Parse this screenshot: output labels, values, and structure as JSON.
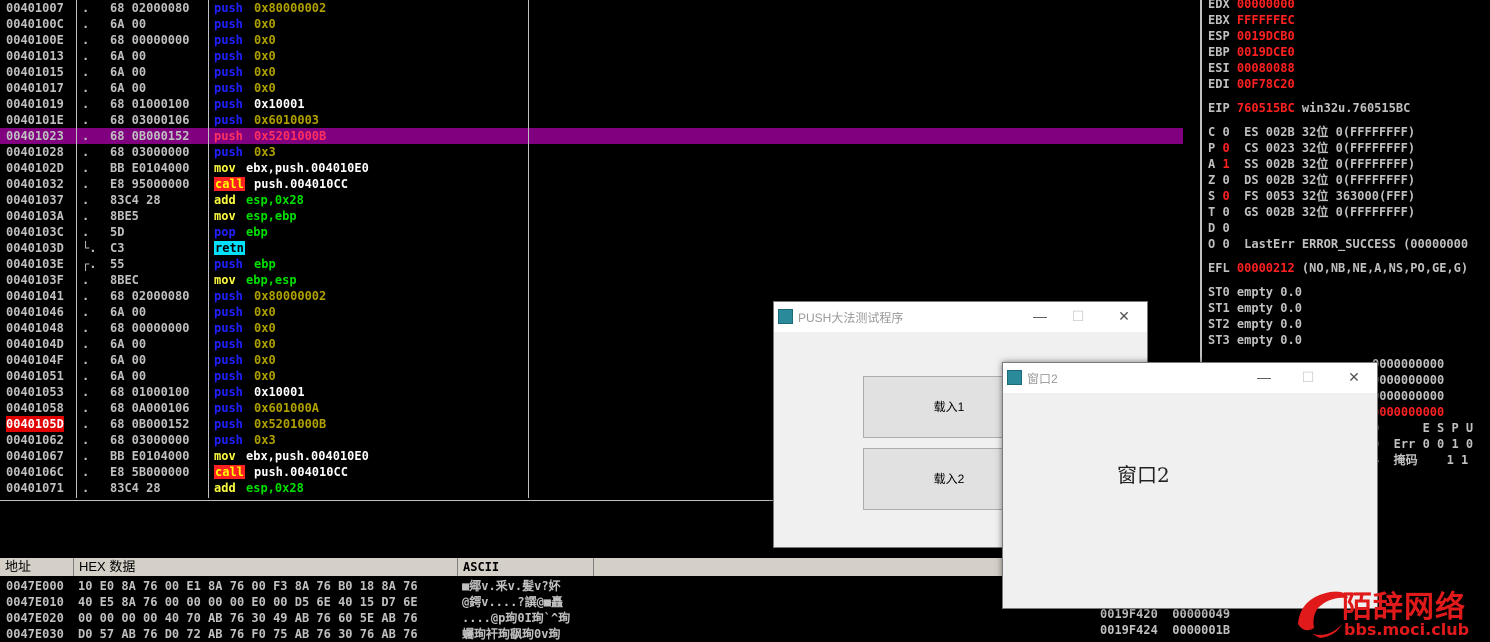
{
  "disasm": {
    "rows": [
      {
        "addr": "00401007",
        "flow": ".",
        "hex": "68 02000080",
        "mn": "push",
        "op": "0x80000002",
        "mc": "blue",
        "oc": "olive"
      },
      {
        "addr": "0040100C",
        "flow": ".",
        "hex": "6A 00",
        "mn": "push",
        "op": "0x0",
        "mc": "blue",
        "oc": "olive"
      },
      {
        "addr": "0040100E",
        "flow": ".",
        "hex": "68 00000000",
        "mn": "push",
        "op": "0x0",
        "mc": "blue",
        "oc": "olive"
      },
      {
        "addr": "00401013",
        "flow": ".",
        "hex": "6A 00",
        "mn": "push",
        "op": "0x0",
        "mc": "blue",
        "oc": "olive"
      },
      {
        "addr": "00401015",
        "flow": ".",
        "hex": "6A 00",
        "mn": "push",
        "op": "0x0",
        "mc": "blue",
        "oc": "olive"
      },
      {
        "addr": "00401017",
        "flow": ".",
        "hex": "6A 00",
        "mn": "push",
        "op": "0x0",
        "mc": "blue",
        "oc": "olive"
      },
      {
        "addr": "00401019",
        "flow": ".",
        "hex": "68 01000100",
        "mn": "push",
        "op": "0x10001",
        "mc": "blue",
        "oc": "white"
      },
      {
        "addr": "0040101E",
        "flow": ".",
        "hex": "68 03000106",
        "mn": "push",
        "op": "0x6010003",
        "mc": "blue",
        "oc": "olive"
      },
      {
        "addr": "00401023",
        "flow": ".",
        "hex": "68 0B000152",
        "mn": "push",
        "op": "0x5201000B",
        "mc": "red",
        "oc": "red",
        "sel": true
      },
      {
        "addr": "00401028",
        "flow": ".",
        "hex": "68 03000000",
        "mn": "push",
        "op": "0x3",
        "mc": "blue",
        "oc": "olive"
      },
      {
        "addr": "0040102D",
        "flow": ".",
        "hex": "BB E0104000",
        "mn": "mov",
        "op": "ebx,push.004010E0",
        "mc": "yellow",
        "oc": "white"
      },
      {
        "addr": "00401032",
        "flow": ".",
        "hex": "E8 95000000",
        "mn": "call",
        "op": "push.004010CC",
        "mc": "call",
        "oc": "white"
      },
      {
        "addr": "00401037",
        "flow": ".",
        "hex": "83C4 28",
        "mn": "add",
        "op": "esp,0x28",
        "mc": "yellow",
        "oc": "green"
      },
      {
        "addr": "0040103A",
        "flow": ".",
        "hex": "8BE5",
        "mn": "mov",
        "op": "esp,ebp",
        "mc": "yellow",
        "oc": "green"
      },
      {
        "addr": "0040103C",
        "flow": ".",
        "hex": "5D",
        "mn": "pop",
        "op": "ebp",
        "mc": "blue",
        "oc": "green"
      },
      {
        "addr": "0040103D",
        "flow": "└.",
        "hex": "C3",
        "mn": "retn",
        "op": "",
        "mc": "retn",
        "oc": "white"
      },
      {
        "addr": "0040103E",
        "flow": "┌.",
        "hex": "55",
        "mn": "push",
        "op": "ebp",
        "mc": "blue",
        "oc": "green"
      },
      {
        "addr": "0040103F",
        "flow": ".",
        "hex": "8BEC",
        "mn": "mov",
        "op": "ebp,esp",
        "mc": "yellow",
        "oc": "green"
      },
      {
        "addr": "00401041",
        "flow": ".",
        "hex": "68 02000080",
        "mn": "push",
        "op": "0x80000002",
        "mc": "blue",
        "oc": "olive"
      },
      {
        "addr": "00401046",
        "flow": ".",
        "hex": "6A 00",
        "mn": "push",
        "op": "0x0",
        "mc": "blue",
        "oc": "olive"
      },
      {
        "addr": "00401048",
        "flow": ".",
        "hex": "68 00000000",
        "mn": "push",
        "op": "0x0",
        "mc": "blue",
        "oc": "olive"
      },
      {
        "addr": "0040104D",
        "flow": ".",
        "hex": "6A 00",
        "mn": "push",
        "op": "0x0",
        "mc": "blue",
        "oc": "olive"
      },
      {
        "addr": "0040104F",
        "flow": ".",
        "hex": "6A 00",
        "mn": "push",
        "op": "0x0",
        "mc": "blue",
        "oc": "olive"
      },
      {
        "addr": "00401051",
        "flow": ".",
        "hex": "6A 00",
        "mn": "push",
        "op": "0x0",
        "mc": "blue",
        "oc": "olive"
      },
      {
        "addr": "00401053",
        "flow": ".",
        "hex": "68 01000100",
        "mn": "push",
        "op": "0x10001",
        "mc": "blue",
        "oc": "white"
      },
      {
        "addr": "00401058",
        "flow": ".",
        "hex": "68 0A000106",
        "mn": "push",
        "op": "0x601000A",
        "mc": "blue",
        "oc": "olive"
      },
      {
        "addr": "0040105D",
        "flow": ".",
        "hex": "68 0B000152",
        "mn": "push",
        "op": "0x5201000B",
        "mc": "blue",
        "oc": "olive",
        "bp": true
      },
      {
        "addr": "00401062",
        "flow": ".",
        "hex": "68 03000000",
        "mn": "push",
        "op": "0x3",
        "mc": "blue",
        "oc": "olive"
      },
      {
        "addr": "00401067",
        "flow": ".",
        "hex": "BB E0104000",
        "mn": "mov",
        "op": "ebx,push.004010E0",
        "mc": "yellow",
        "oc": "white"
      },
      {
        "addr": "0040106C",
        "flow": ".",
        "hex": "E8 5B000000",
        "mn": "call",
        "op": "push.004010CC",
        "mc": "call",
        "oc": "white"
      },
      {
        "addr": "00401071",
        "flow": ".",
        "hex": "83C4 28",
        "mn": "add",
        "op": "esp,0x28",
        "mc": "yellow",
        "oc": "green"
      }
    ]
  },
  "dump": {
    "headers": {
      "addr": "地址",
      "hex": "HEX 数据",
      "ascii": "ASCII"
    },
    "rows": [
      {
        "addr": "0047E000",
        "hex": "10 E0 8A 76 00 E1 8A 76 00 F3 8A 76 B0 18 8A 76",
        "ascii": "■鄊v.釆v.髪v?妚"
      },
      {
        "addr": "0047E010",
        "hex": "40 E5 8A 76 00 00 00 00 E0 00 D5 6E 40 15 D7 6E",
        "ascii": "@鍔v....?譔@■矗"
      },
      {
        "addr": "0047E020",
        "hex": "00 00 00 00 40 70 AB 76 30 49 AB 76 60 5E AB 76",
        "ascii": "....@p珣0I珣`^珣"
      },
      {
        "addr": "0047E030",
        "hex": "D0 57 AB 76 D0 72 AB 76 F0 75 AB 76 30 76 AB 76",
        "ascii": "蠾珣衦珣飖珣0v珣"
      }
    ]
  },
  "registers": {
    "gp": [
      {
        "name": "EDX",
        "val": "00000000"
      },
      {
        "name": "EBX",
        "val": "FFFFFFEC"
      },
      {
        "name": "ESP",
        "val": "0019DCB0"
      },
      {
        "name": "EBP",
        "val": "0019DCE0"
      },
      {
        "name": "ESI",
        "val": "00080088"
      },
      {
        "name": "EDI",
        "val": "00F78C20"
      }
    ],
    "eip": {
      "name": "EIP",
      "val": "760515BC",
      "sym": "win32u.760515BC"
    },
    "flags": [
      {
        "f": "C",
        "v": "0",
        "red": false,
        "seg": "ES 002B 32位 0(FFFFFFFF)"
      },
      {
        "f": "P",
        "v": "0",
        "red": true,
        "seg": "CS 0023 32位 0(FFFFFFFF)"
      },
      {
        "f": "A",
        "v": "1",
        "red": true,
        "seg": "SS 002B 32位 0(FFFFFFFF)"
      },
      {
        "f": "Z",
        "v": "0",
        "red": false,
        "seg": "DS 002B 32位 0(FFFFFFFF)"
      },
      {
        "f": "S",
        "v": "0",
        "red": true,
        "seg": "FS 0053 32位 363000(FFF)"
      },
      {
        "f": "T",
        "v": "0",
        "red": false,
        "seg": "GS 002B 32位 0(FFFFFFFF)"
      },
      {
        "f": "D",
        "v": "0",
        "red": false,
        "seg": ""
      },
      {
        "f": "O",
        "v": "0",
        "red": false,
        "seg": "LastErr ERROR_SUCCESS (00000000"
      }
    ],
    "efl": {
      "name": "EFL",
      "val": "00000212",
      "desc": "(NO,NB,NE,A,NS,PO,GE,G)"
    },
    "st": [
      {
        "name": "ST0",
        "val": "empty 0.0"
      },
      {
        "name": "ST1",
        "val": "empty 0.0"
      },
      {
        "name": "ST2",
        "val": "empty 0.0"
      },
      {
        "name": "ST3",
        "val": "empty 0.0"
      }
    ],
    "partial": [
      {
        "text": "0000000000",
        "red": false
      },
      {
        "text": "0000000000",
        "red": false
      },
      {
        "text": "0000000000",
        "red": false
      },
      {
        "text": "0000000000",
        "red": true
      },
      {
        "text": "0      E S P U",
        "red": false
      },
      {
        "text": "0  Err 0 0 1 0",
        "red": false
      },
      {
        "text": "4  掩码    1 1",
        "red": false
      }
    ]
  },
  "stack": {
    "rows": [
      {
        "addr": "0019F420",
        "val": "00000049"
      },
      {
        "addr": "0019F424",
        "val": "0000001B"
      }
    ]
  },
  "win1": {
    "title": "PUSH大法测试程序",
    "btn1": "载入1",
    "btn2": "载入2",
    "min": "—",
    "max": "☐",
    "close": "✕"
  },
  "win2": {
    "title": "窗口2",
    "label": "窗口2",
    "min": "—",
    "max": "☐",
    "close": "✕"
  },
  "watermark": {
    "text": "陌辞网络",
    "url": "bbs.moci.club"
  }
}
